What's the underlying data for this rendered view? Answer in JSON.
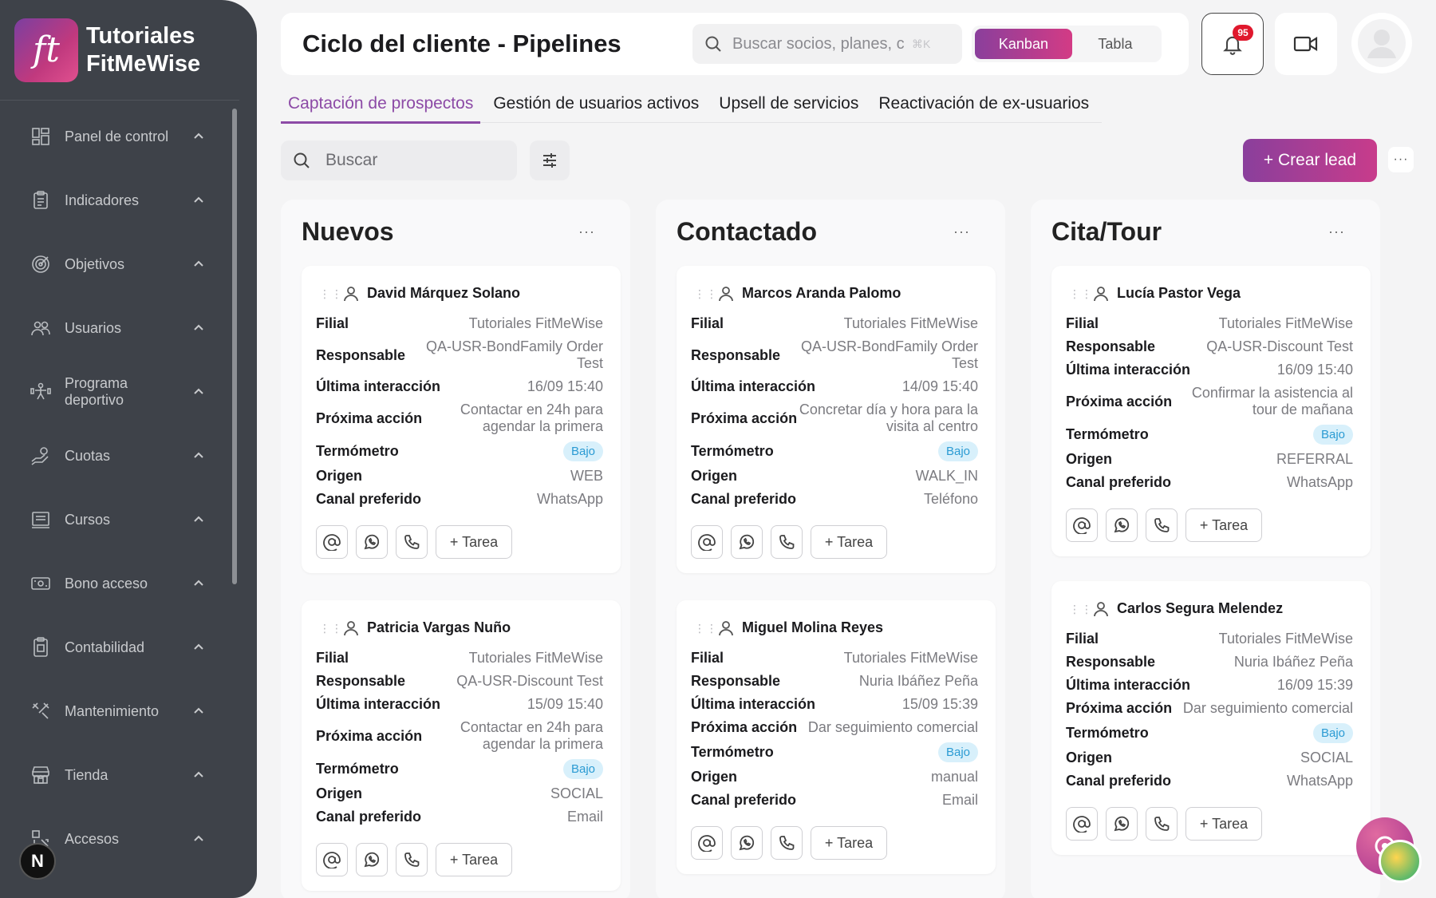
{
  "brand": {
    "line1": "Tutoriales",
    "line2": "FitMeWise",
    "logo_text": "ft"
  },
  "sidebar": {
    "items": [
      {
        "label": "Panel de control",
        "icon": "dashboard-icon"
      },
      {
        "label": "Indicadores",
        "icon": "clipboard-icon"
      },
      {
        "label": "Objetivos",
        "icon": "target-icon"
      },
      {
        "label": "Usuarios",
        "icon": "users-icon"
      },
      {
        "label": "Programa deportivo",
        "icon": "sport-icon"
      },
      {
        "label": "Cuotas",
        "icon": "hand-money-icon"
      },
      {
        "label": "Cursos",
        "icon": "course-icon"
      },
      {
        "label": "Bono acceso",
        "icon": "ticket-icon"
      },
      {
        "label": "Contabilidad",
        "icon": "accounting-icon"
      },
      {
        "label": "Mantenimiento",
        "icon": "tools-icon"
      },
      {
        "label": "Tienda",
        "icon": "store-icon"
      },
      {
        "label": "Accesos",
        "icon": "access-icon"
      }
    ],
    "user_initial": "N"
  },
  "header": {
    "title": "Ciclo del cliente - Pipelines",
    "search_placeholder": "Buscar socios, planes, c",
    "shortcut": "⌘K",
    "view_kanban": "Kanban",
    "view_table": "Tabla",
    "notifications_count": "95"
  },
  "tabs": [
    "Captación de prospectos",
    "Gestión de usuarios activos",
    "Upsell de servicios",
    "Reactivación de ex-usuarios"
  ],
  "toolbar": {
    "search_placeholder": "Buscar",
    "create_label": "+ Crear lead",
    "more": "···"
  },
  "labels": {
    "filial": "Filial",
    "responsable": "Responsable",
    "ultima": "Última interacción",
    "proxima": "Próxima acción",
    "termometro": "Termómetro",
    "origen": "Origen",
    "canal": "Canal preferido",
    "task": "+ Tarea"
  },
  "columns": [
    {
      "title": "Nuevos",
      "cards": [
        {
          "name": "David Márquez Solano",
          "filial": "Tutoriales FitMeWise",
          "responsable": "QA-USR-BondFamily Order Test",
          "ultima": "16/09 15:40",
          "proxima": "Contactar en 24h para agendar la primera",
          "termometro": "Bajo",
          "origen": "WEB",
          "canal": "WhatsApp"
        },
        {
          "name": "Patricia Vargas Nuño",
          "filial": "Tutoriales FitMeWise",
          "responsable": "QA-USR-Discount Test",
          "ultima": "15/09 15:40",
          "proxima": "Contactar en 24h para agendar la primera",
          "termometro": "Bajo",
          "origen": "SOCIAL",
          "canal": "Email"
        }
      ]
    },
    {
      "title": "Contactado",
      "cards": [
        {
          "name": "Marcos Aranda Palomo",
          "filial": "Tutoriales FitMeWise",
          "responsable": "QA-USR-BondFamily Order Test",
          "ultima": "14/09 15:40",
          "proxima": "Concretar día y hora para la visita al centro",
          "termometro": "Bajo",
          "origen": "WALK_IN",
          "canal": "Teléfono"
        },
        {
          "name": "Miguel Molina Reyes",
          "filial": "Tutoriales FitMeWise",
          "responsable": "Nuria Ibáñez Peña",
          "ultima": "15/09 15:39",
          "proxima": "Dar seguimiento comercial",
          "termometro": "Bajo",
          "origen": "manual",
          "canal": "Email"
        }
      ]
    },
    {
      "title": "Cita/Tour",
      "cards": [
        {
          "name": "Lucía Pastor Vega",
          "filial": "Tutoriales FitMeWise",
          "responsable": "QA-USR-Discount Test",
          "ultima": "16/09 15:40",
          "proxima": "Confirmar la asistencia al tour de mañana",
          "termometro": "Bajo",
          "origen": "REFERRAL",
          "canal": "WhatsApp"
        },
        {
          "name": "Carlos Segura Melendez",
          "filial": "Tutoriales FitMeWise",
          "responsable": "Nuria Ibáñez Peña",
          "ultima": "16/09 15:39",
          "proxima": "Dar seguimiento comercial",
          "termometro": "Bajo",
          "origen": "SOCIAL",
          "canal": "WhatsApp"
        }
      ]
    }
  ]
}
